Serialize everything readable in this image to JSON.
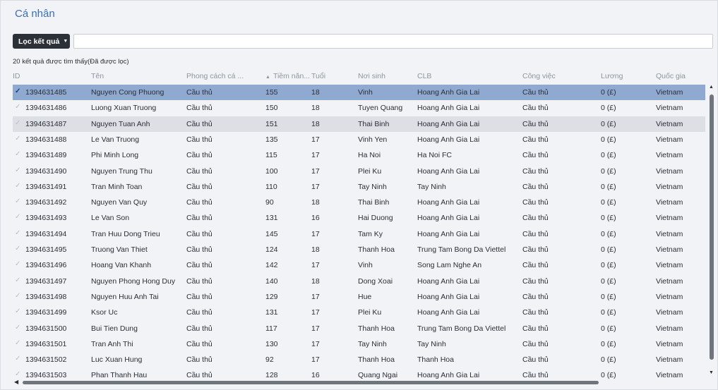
{
  "title": "Cá nhân",
  "filter_button": {
    "label": "Lọc kết quả",
    "value": ""
  },
  "result_count": "20 kết quả được tìm thấy(Đã được lọc)",
  "columns": [
    "ID",
    "Tên",
    "Phong cách cá ...",
    "Tiềm năn...",
    "Tuổi",
    "Nơi sinh",
    "CLB",
    "Công việc",
    "Lương",
    "Quốc gia"
  ],
  "sorted_column_index": 3,
  "selected_row_index": 0,
  "hover_row_index": 2,
  "rows": [
    [
      "1394631485",
      "Nguyen Cong Phuong",
      "Cầu thủ",
      "155",
      "18",
      "Vinh",
      "Hoang Anh Gia Lai",
      "Cầu thủ",
      "0 (£)",
      "Vietnam"
    ],
    [
      "1394631486",
      "Luong Xuan Truong",
      "Cầu thủ",
      "150",
      "18",
      "Tuyen Quang",
      "Hoang Anh Gia Lai",
      "Cầu thủ",
      "0 (£)",
      "Vietnam"
    ],
    [
      "1394631487",
      "Nguyen Tuan Anh",
      "Cầu thủ",
      "151",
      "18",
      "Thai Binh",
      "Hoang Anh Gia Lai",
      "Cầu thủ",
      "0 (£)",
      "Vietnam"
    ],
    [
      "1394631488",
      "Le Van Truong",
      "Cầu thủ",
      "135",
      "17",
      "Vinh Yen",
      "Hoang Anh Gia Lai",
      "Cầu thủ",
      "0 (£)",
      "Vietnam"
    ],
    [
      "1394631489",
      "Phi Minh Long",
      "Cầu thủ",
      "115",
      "17",
      "Ha Noi",
      "Ha Noi FC",
      "Cầu thủ",
      "0 (£)",
      "Vietnam"
    ],
    [
      "1394631490",
      "Nguyen Trung Thu",
      "Cầu thủ",
      "100",
      "17",
      "Plei Ku",
      "Hoang Anh Gia Lai",
      "Cầu thủ",
      "0 (£)",
      "Vietnam"
    ],
    [
      "1394631491",
      "Tran Minh Toan",
      "Cầu thủ",
      "110",
      "17",
      "Tay Ninh",
      "Tay Ninh",
      "Cầu thủ",
      "0 (£)",
      "Vietnam"
    ],
    [
      "1394631492",
      "Nguyen Van Quy",
      "Cầu thủ",
      "90",
      "18",
      "Thai Binh",
      "Hoang Anh Gia Lai",
      "Cầu thủ",
      "0 (£)",
      "Vietnam"
    ],
    [
      "1394631493",
      "Le Van Son",
      "Cầu thủ",
      "131",
      "16",
      "Hai Duong",
      "Hoang Anh Gia Lai",
      "Cầu thủ",
      "0 (£)",
      "Vietnam"
    ],
    [
      "1394631494",
      "Tran Huu Dong Trieu",
      "Cầu thủ",
      "145",
      "17",
      "Tam Ky",
      "Hoang Anh Gia Lai",
      "Cầu thủ",
      "0 (£)",
      "Vietnam"
    ],
    [
      "1394631495",
      "Truong Van Thiet",
      "Cầu thủ",
      "124",
      "18",
      "Thanh Hoa",
      "Trung Tam Bong Da Viettel",
      "Cầu thủ",
      "0 (£)",
      "Vietnam"
    ],
    [
      "1394631496",
      "Hoang Van Khanh",
      "Cầu thủ",
      "142",
      "17",
      "Vinh",
      "Song Lam Nghe An",
      "Cầu thủ",
      "0 (£)",
      "Vietnam"
    ],
    [
      "1394631497",
      "Nguyen Phong Hong Duy",
      "Cầu thủ",
      "140",
      "18",
      "Dong Xoai",
      "Hoang Anh Gia Lai",
      "Cầu thủ",
      "0 (£)",
      "Vietnam"
    ],
    [
      "1394631498",
      "Nguyen Huu Anh Tai",
      "Cầu thủ",
      "129",
      "17",
      "Hue",
      "Hoang Anh Gia Lai",
      "Cầu thủ",
      "0 (£)",
      "Vietnam"
    ],
    [
      "1394631499",
      "Ksor Uc",
      "Cầu thủ",
      "131",
      "17",
      "Plei Ku",
      "Hoang Anh Gia Lai",
      "Cầu thủ",
      "0 (£)",
      "Vietnam"
    ],
    [
      "1394631500",
      "Bui Tien Dung",
      "Cầu thủ",
      "117",
      "17",
      "Thanh Hoa",
      "Trung Tam Bong Da Viettel",
      "Cầu thủ",
      "0 (£)",
      "Vietnam"
    ],
    [
      "1394631501",
      "Tran Anh Thi",
      "Cầu thủ",
      "130",
      "17",
      "Tay Ninh",
      "Tay Ninh",
      "Cầu thủ",
      "0 (£)",
      "Vietnam"
    ],
    [
      "1394631502",
      "Luc Xuan Hung",
      "Cầu thủ",
      "92",
      "17",
      "Thanh Hoa",
      "Thanh Hoa",
      "Cầu thủ",
      "0 (£)",
      "Vietnam"
    ],
    [
      "1394631503",
      "Phan Thanh Hau",
      "Cầu thủ",
      "128",
      "16",
      "Quang Ngai",
      "Hoang Anh Gia Lai",
      "Cầu thủ",
      "0 (£)",
      "Vietnam"
    ]
  ]
}
